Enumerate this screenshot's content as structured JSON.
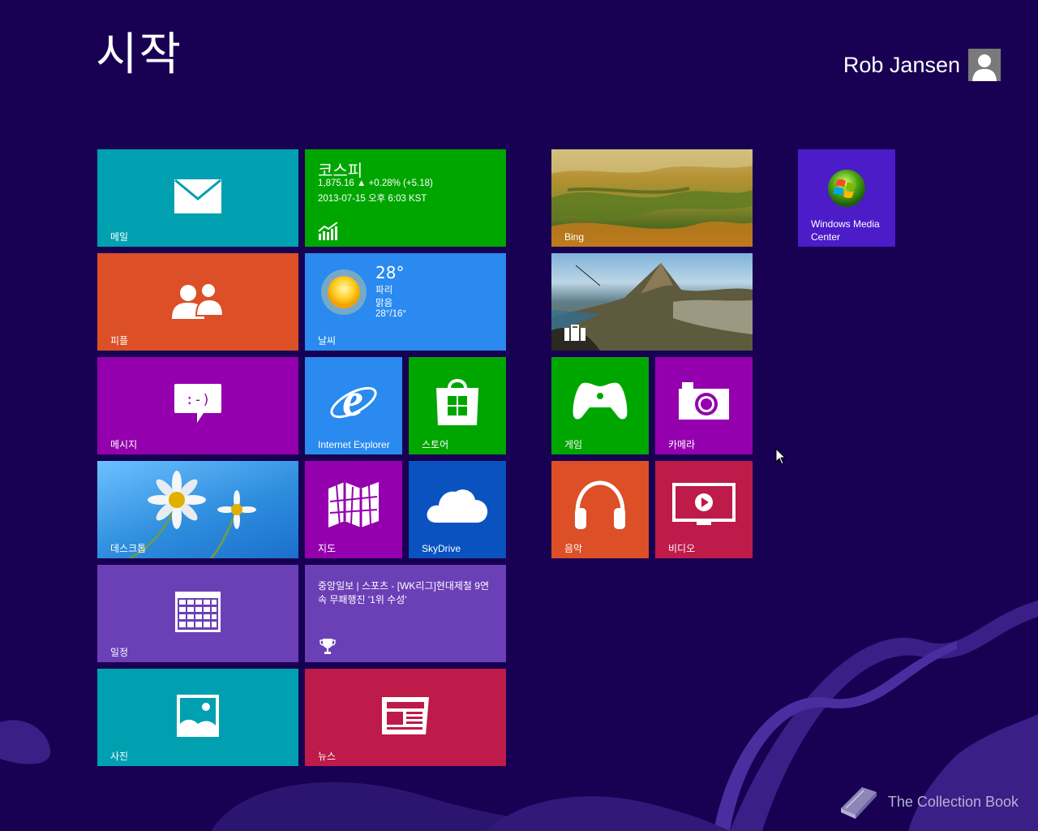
{
  "header": {
    "title": "시작",
    "user_name": "Rob Jansen"
  },
  "tiles": {
    "mail": {
      "label": "메일",
      "icon": "mail-icon",
      "color": "#00A0B1"
    },
    "finance": {
      "title": "코스피",
      "value_line": "1,875.16  ▲ +0.28% (+5.18)",
      "date_line": "2013-07-15 오후 6:03 KST",
      "icon": "chart-icon",
      "color": "#00A600"
    },
    "people": {
      "label": "피플",
      "icon": "people-icon",
      "color": "#DC4F27"
    },
    "weather": {
      "temp": "28°",
      "city": "파리",
      "condition": "맑음",
      "range": "28°/16°",
      "label": "날씨",
      "icon": "sun-icon",
      "color": "#2A8AEF"
    },
    "messaging": {
      "label": "메시지",
      "icon": "message-icon",
      "color": "#9400AE"
    },
    "ie": {
      "label": "Internet Explorer",
      "icon": "internet-explorer-icon",
      "color": "#2A8AEF"
    },
    "store": {
      "label": "스토어",
      "icon": "store-icon",
      "color": "#00A600"
    },
    "desktop": {
      "label": "데스크톱",
      "icon": "daisy-wallpaper",
      "color": "#3C9BE0"
    },
    "maps": {
      "label": "지도",
      "icon": "map-icon",
      "color": "#9400AE"
    },
    "skydrive": {
      "label": "SkyDrive",
      "icon": "cloud-icon",
      "color": "#0A52C0"
    },
    "calendar": {
      "label": "일정",
      "icon": "calendar-icon",
      "color": "#6B3FB6"
    },
    "sports": {
      "headline": "중앙일보 | 스포츠 - [WK리그]현대제철 9연속 무패행진 '1위 수성'",
      "icon": "trophy-icon",
      "color": "#6B3FB6"
    },
    "photos": {
      "label": "사진",
      "icon": "photo-icon",
      "color": "#00A0B1"
    },
    "news": {
      "label": "뉴스",
      "icon": "newspaper-icon",
      "color": "#BE1A4A"
    },
    "bing": {
      "label": "Bing",
      "icon": "landscape-photo",
      "color": "#8C9A3A"
    },
    "travel": {
      "icon": "suitcase-icon",
      "color": "#3E6E8C"
    },
    "games": {
      "label": "게임",
      "icon": "xbox-controller-icon",
      "color": "#00A600"
    },
    "camera": {
      "label": "카메라",
      "icon": "camera-icon",
      "color": "#9400AE"
    },
    "music": {
      "label": "음악",
      "icon": "headphones-icon",
      "color": "#DC4F27"
    },
    "video": {
      "label": "비디오",
      "icon": "video-icon",
      "color": "#BE1A4A"
    },
    "wmc": {
      "label": "Windows Media Center",
      "icon": "windows-logo-icon",
      "color": "#4B1CC8"
    }
  },
  "watermark": "The Collection Book"
}
